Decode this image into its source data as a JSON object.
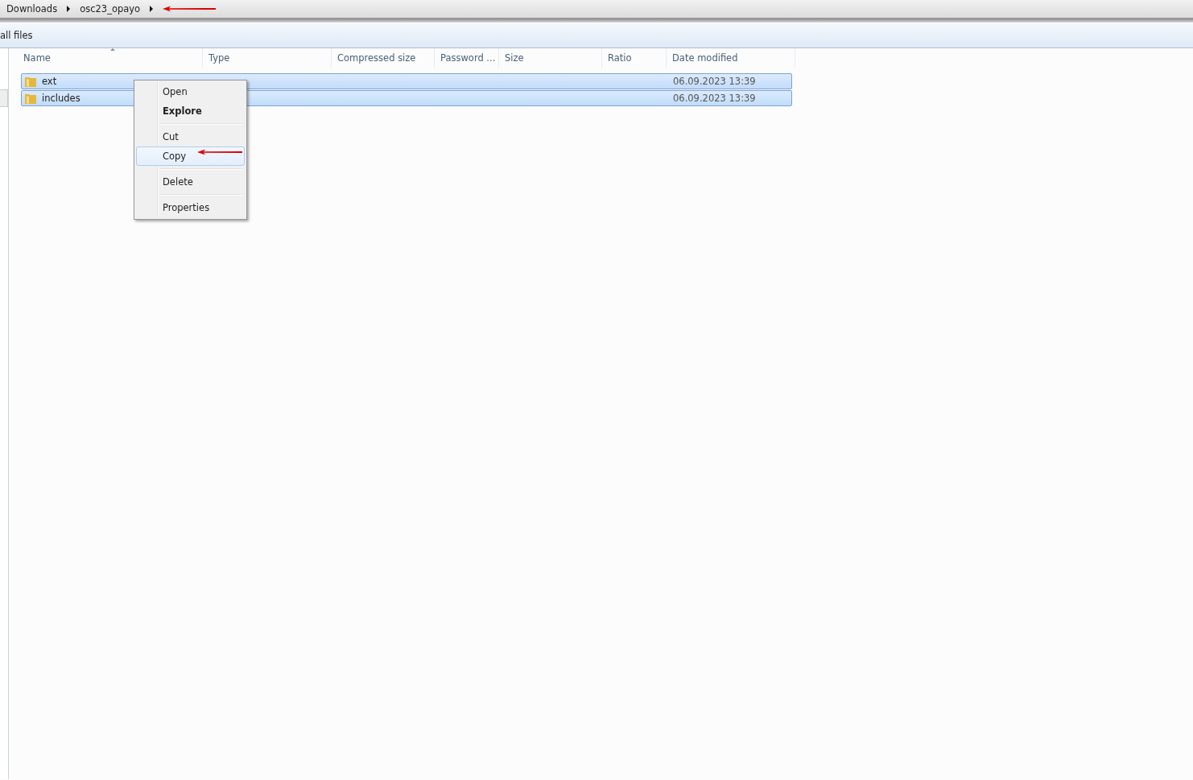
{
  "breadcrumb": [
    "Downloads",
    "osc23_opayo"
  ],
  "toolbar": {
    "label": "all files"
  },
  "table": {
    "columns": [
      {
        "label": "Name",
        "sorted": true
      },
      {
        "label": "Type",
        "sorted": false
      },
      {
        "label": "Compressed size",
        "sorted": false
      },
      {
        "label": "Password ...",
        "sorted": false
      },
      {
        "label": "Size",
        "sorted": false
      },
      {
        "label": "Ratio",
        "sorted": false
      },
      {
        "label": "Date modified",
        "sorted": false
      }
    ],
    "rows": [
      {
        "name": "ext",
        "date_modified": "06.09.2023 13:39",
        "selected": true
      },
      {
        "name": "includes",
        "date_modified": "06.09.2023 13:39",
        "selected": true
      }
    ]
  },
  "context_menu": [
    {
      "kind": "item",
      "label": "Open",
      "default": false,
      "selected": false
    },
    {
      "kind": "item",
      "label": "Explore",
      "default": true,
      "selected": false
    },
    {
      "kind": "separator"
    },
    {
      "kind": "item",
      "label": "Cut",
      "default": false,
      "selected": false
    },
    {
      "kind": "item",
      "label": "Copy",
      "default": false,
      "selected": true
    },
    {
      "kind": "separator"
    },
    {
      "kind": "item",
      "label": "Delete",
      "default": false,
      "selected": false
    },
    {
      "kind": "separator"
    },
    {
      "kind": "item",
      "label": "Properties",
      "default": false,
      "selected": false
    }
  ]
}
